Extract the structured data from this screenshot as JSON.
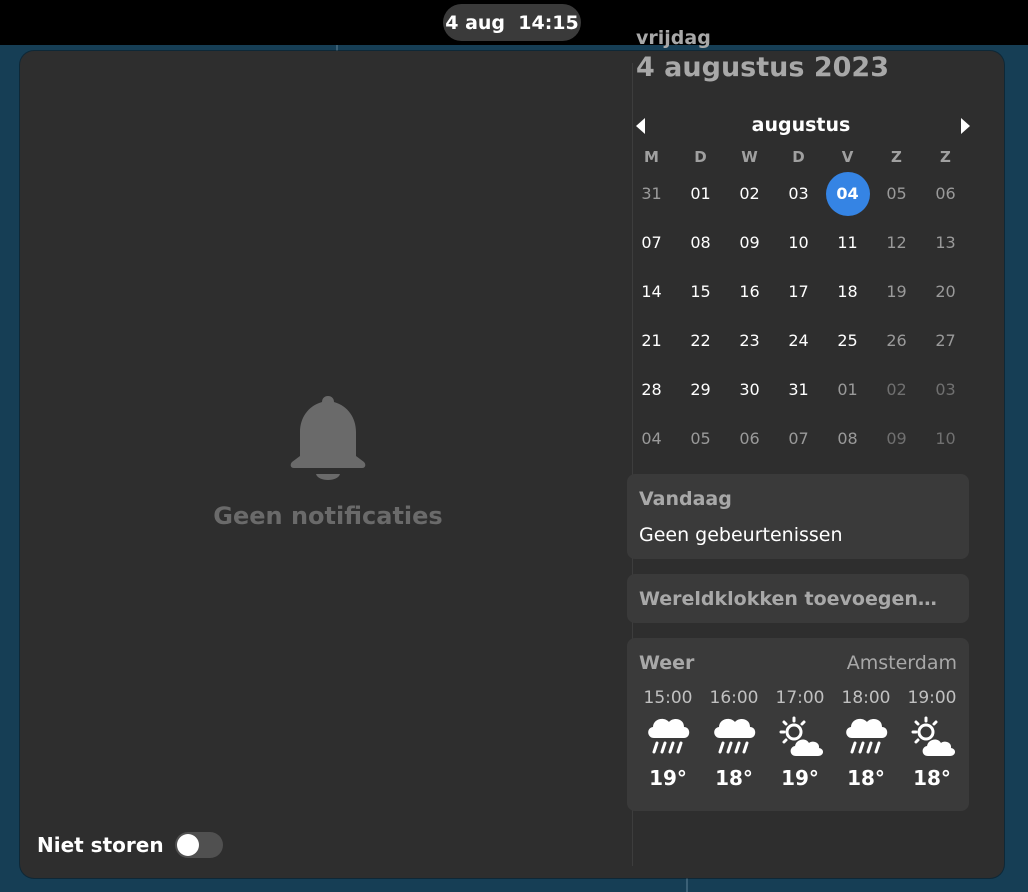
{
  "topbar": {
    "clock": "4 aug  14:15"
  },
  "notifications": {
    "empty_text": "Geen notificaties",
    "dnd_label": "Niet storen",
    "dnd_enabled": false
  },
  "calendar": {
    "weekday": "vrijdag",
    "full_date": "4 augustus 2023",
    "month": "augustus",
    "day_headers": [
      "M",
      "D",
      "W",
      "D",
      "V",
      "Z",
      "Z"
    ],
    "weeks": [
      [
        "31",
        "01",
        "02",
        "03",
        "04",
        "05",
        "06"
      ],
      [
        "07",
        "08",
        "09",
        "10",
        "11",
        "12",
        "13"
      ],
      [
        "14",
        "15",
        "16",
        "17",
        "18",
        "19",
        "20"
      ],
      [
        "21",
        "22",
        "23",
        "24",
        "25",
        "26",
        "27"
      ],
      [
        "28",
        "29",
        "30",
        "31",
        "01",
        "02",
        "03"
      ],
      [
        "04",
        "05",
        "06",
        "07",
        "08",
        "09",
        "10"
      ]
    ],
    "today": "04",
    "accent_color": "#3584e4"
  },
  "events": {
    "title": "Vandaag",
    "text": "Geen gebeurtenissen"
  },
  "world_clocks": {
    "label": "Wereldklokken toevoegen…"
  },
  "weather": {
    "title": "Weer",
    "location": "Amsterdam",
    "forecast": [
      {
        "time": "15:00",
        "icon": "rain-icon",
        "temp": "19°"
      },
      {
        "time": "16:00",
        "icon": "rain-icon",
        "temp": "18°"
      },
      {
        "time": "17:00",
        "icon": "partly-cloudy-icon",
        "temp": "19°"
      },
      {
        "time": "18:00",
        "icon": "rain-icon",
        "temp": "18°"
      },
      {
        "time": "19:00",
        "icon": "partly-cloudy-icon",
        "temp": "18°"
      }
    ]
  }
}
